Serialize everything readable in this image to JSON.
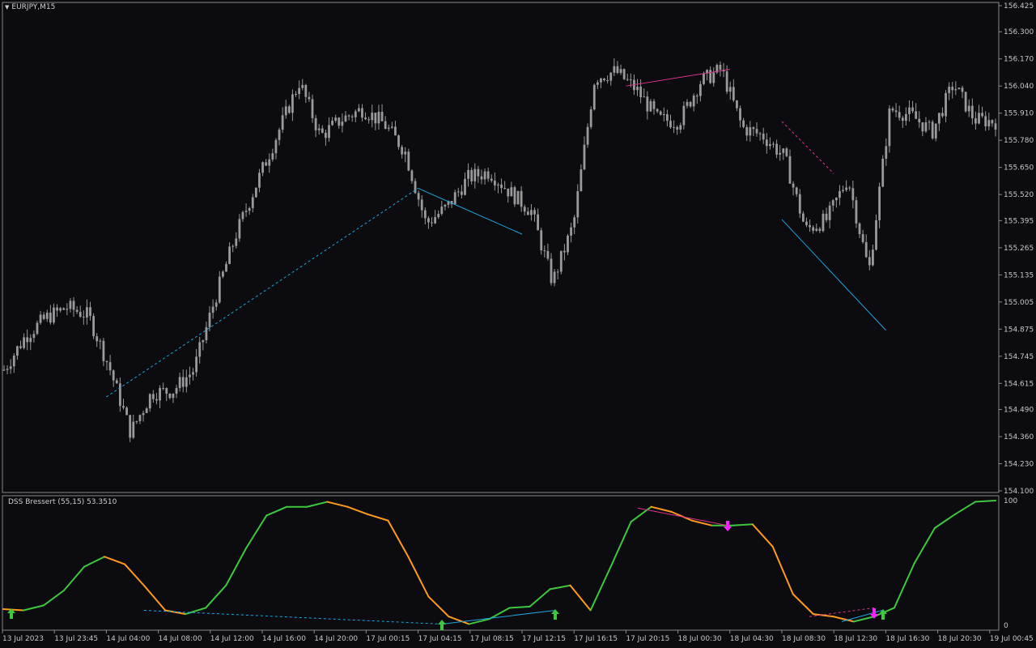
{
  "window": {
    "symbol_label": "EURJPY,M15",
    "menu_icon": "triangle-down-icon"
  },
  "price_axis": {
    "ticks": [
      "156.425",
      "156.300",
      "156.170",
      "156.040",
      "155.910",
      "155.780",
      "155.650",
      "155.520",
      "155.395",
      "155.265",
      "155.135",
      "155.005",
      "154.875",
      "154.745",
      "154.615",
      "154.490",
      "154.360",
      "154.230",
      "154.100"
    ]
  },
  "time_axis": {
    "ticks": [
      "13 Jul 2023",
      "13 Jul 23:45",
      "14 Jul 04:00",
      "14 Jul 08:00",
      "14 Jul 12:00",
      "14 Jul 16:00",
      "14 Jul 20:00",
      "17 Jul 00:15",
      "17 Jul 04:15",
      "17 Jul 08:15",
      "17 Jul 12:15",
      "17 Jul 16:15",
      "17 Jul 20:15",
      "18 Jul 00:30",
      "18 Jul 04:30",
      "18 Jul 08:30",
      "18 Jul 12:30",
      "18 Jul 16:30",
      "18 Jul 20:30",
      "19 Jul 00:45"
    ]
  },
  "indicator": {
    "label": "DSS Bressert (55,15) 53.3510",
    "scale_top": "100",
    "scale_bottom": "0"
  },
  "colors": {
    "background": "#0b0b10",
    "candle": "#9a9a9a",
    "rising": "#3ec83e",
    "falling": "#ff9a1f",
    "bull_div": "#1fa6e0",
    "bear_div": "#e0358c",
    "buy_arrow": "#3ec83e",
    "sell_arrow": "#ff20ff"
  },
  "chart_data": [
    {
      "type": "candlestick",
      "title": "EURJPY,M15",
      "ylim": [
        154.1,
        156.425
      ],
      "x": [
        "13 Jul 2023",
        "13 Jul 23:45",
        "14 Jul 04:00",
        "14 Jul 08:00",
        "14 Jul 12:00",
        "14 Jul 16:00",
        "14 Jul 20:00",
        "17 Jul 00:15",
        "17 Jul 04:15",
        "17 Jul 08:15",
        "17 Jul 12:15",
        "17 Jul 16:15",
        "17 Jul 20:15",
        "18 Jul 00:30",
        "18 Jul 04:30",
        "18 Jul 08:30",
        "18 Jul 12:30",
        "18 Jul 16:30",
        "18 Jul 20:30",
        "19 Jul 00:45"
      ],
      "close_path": [
        154.68,
        154.84,
        154.93,
        154.98,
        154.94,
        154.69,
        154.38,
        154.57,
        154.58,
        154.68,
        155.02,
        155.33,
        155.58,
        155.82,
        156.06,
        155.8,
        155.88,
        155.93,
        155.86,
        155.73,
        155.38,
        155.46,
        155.6,
        155.63,
        155.53,
        155.44,
        155.1,
        155.38,
        156.08,
        156.11,
        156.02,
        155.88,
        155.87,
        156.06,
        156.12,
        155.84,
        155.8,
        155.7,
        155.35,
        155.4,
        155.6,
        155.15,
        155.93,
        155.9,
        155.82,
        156.05,
        155.88,
        155.87
      ],
      "annotations": [
        {
          "kind": "divergence-dashed",
          "color": "bull_div",
          "from": [
            154.55,
            "14 Jul 04:00"
          ],
          "to": [
            155.55,
            "17 Jul 04:15"
          ]
        },
        {
          "kind": "divergence-solid",
          "color": "bull_div",
          "from": [
            155.55,
            "17 Jul 04:15"
          ],
          "to": [
            155.33,
            "17 Jul 12:15"
          ]
        },
        {
          "kind": "divergence-solid",
          "color": "bear_div",
          "from": [
            156.04,
            "17 Jul 20:15"
          ],
          "to": [
            156.12,
            "18 Jul 04:30"
          ]
        },
        {
          "kind": "divergence-dashed",
          "color": "bear_div",
          "from": [
            155.87,
            "18 Jul 08:30"
          ],
          "to": [
            155.62,
            "18 Jul 12:30"
          ]
        },
        {
          "kind": "divergence-solid",
          "color": "bull_div",
          "from": [
            155.4,
            "18 Jul 08:30"
          ],
          "to": [
            154.87,
            "18 Jul 16:30"
          ]
        }
      ]
    },
    {
      "type": "line",
      "title": "DSS Bressert (55,15) 53.3510",
      "ylim": [
        0,
        100
      ],
      "values": [
        13,
        12,
        16,
        28,
        47,
        55,
        49,
        31,
        12,
        9,
        14,
        32,
        62,
        88,
        95,
        95,
        99,
        95,
        89,
        84,
        55,
        23,
        7,
        1,
        5,
        14,
        15,
        29,
        32,
        12,
        47,
        83,
        95,
        91,
        84,
        80,
        80,
        81,
        63,
        25,
        9,
        7,
        3,
        7,
        14,
        50,
        78,
        89,
        99,
        100
      ]
    }
  ]
}
